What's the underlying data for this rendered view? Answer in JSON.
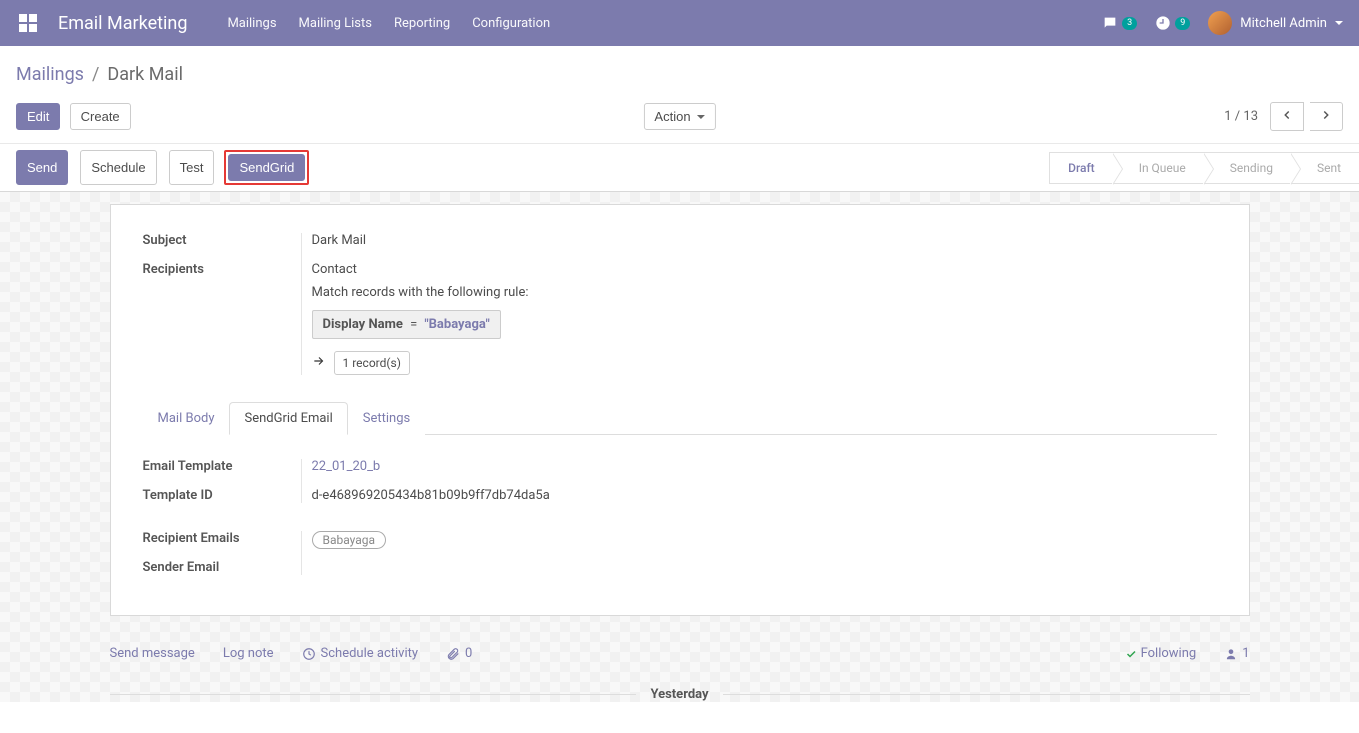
{
  "app": {
    "title": "Email Marketing",
    "menu": [
      "Mailings",
      "Mailing Lists",
      "Reporting",
      "Configuration"
    ],
    "messages_badge": "3",
    "activities_badge": "9",
    "user": "Mitchell Admin"
  },
  "breadcrumb": {
    "parent": "Mailings",
    "current": "Dark Mail"
  },
  "buttons": {
    "edit": "Edit",
    "create": "Create",
    "action": "Action"
  },
  "pager": {
    "text": "1 / 13"
  },
  "statusbar": {
    "buttons": {
      "send": "Send",
      "schedule": "Schedule",
      "test": "Test",
      "sendgrid": "SendGrid"
    },
    "steps": [
      "Draft",
      "In Queue",
      "Sending",
      "Sent"
    ],
    "active_step": "Draft"
  },
  "form": {
    "subject": {
      "label": "Subject",
      "value": "Dark Mail"
    },
    "recipients": {
      "label": "Recipients",
      "value": "Contact",
      "match_text": "Match records with the following rule:",
      "rule": {
        "field": "Display Name",
        "op": "=",
        "value": "\"Babayaga\""
      },
      "records": "1 record(s)"
    },
    "tabs": [
      "Mail Body",
      "SendGrid Email",
      "Settings"
    ],
    "active_tab": "SendGrid Email",
    "fields": {
      "email_template": {
        "label": "Email Template",
        "value": "22_01_20_b"
      },
      "template_id": {
        "label": "Template ID",
        "value": "d-e468969205434b81b09b9ff7db74da5a"
      },
      "recipient_emails": {
        "label": "Recipient Emails",
        "tags": [
          "Babayaga"
        ]
      },
      "sender_email": {
        "label": "Sender Email",
        "value": ""
      }
    }
  },
  "chatter": {
    "send_message": "Send message",
    "log_note": "Log note",
    "schedule_activity": "Schedule activity",
    "attachments": "0",
    "following": "Following",
    "followers": "1",
    "day": "Yesterday"
  }
}
